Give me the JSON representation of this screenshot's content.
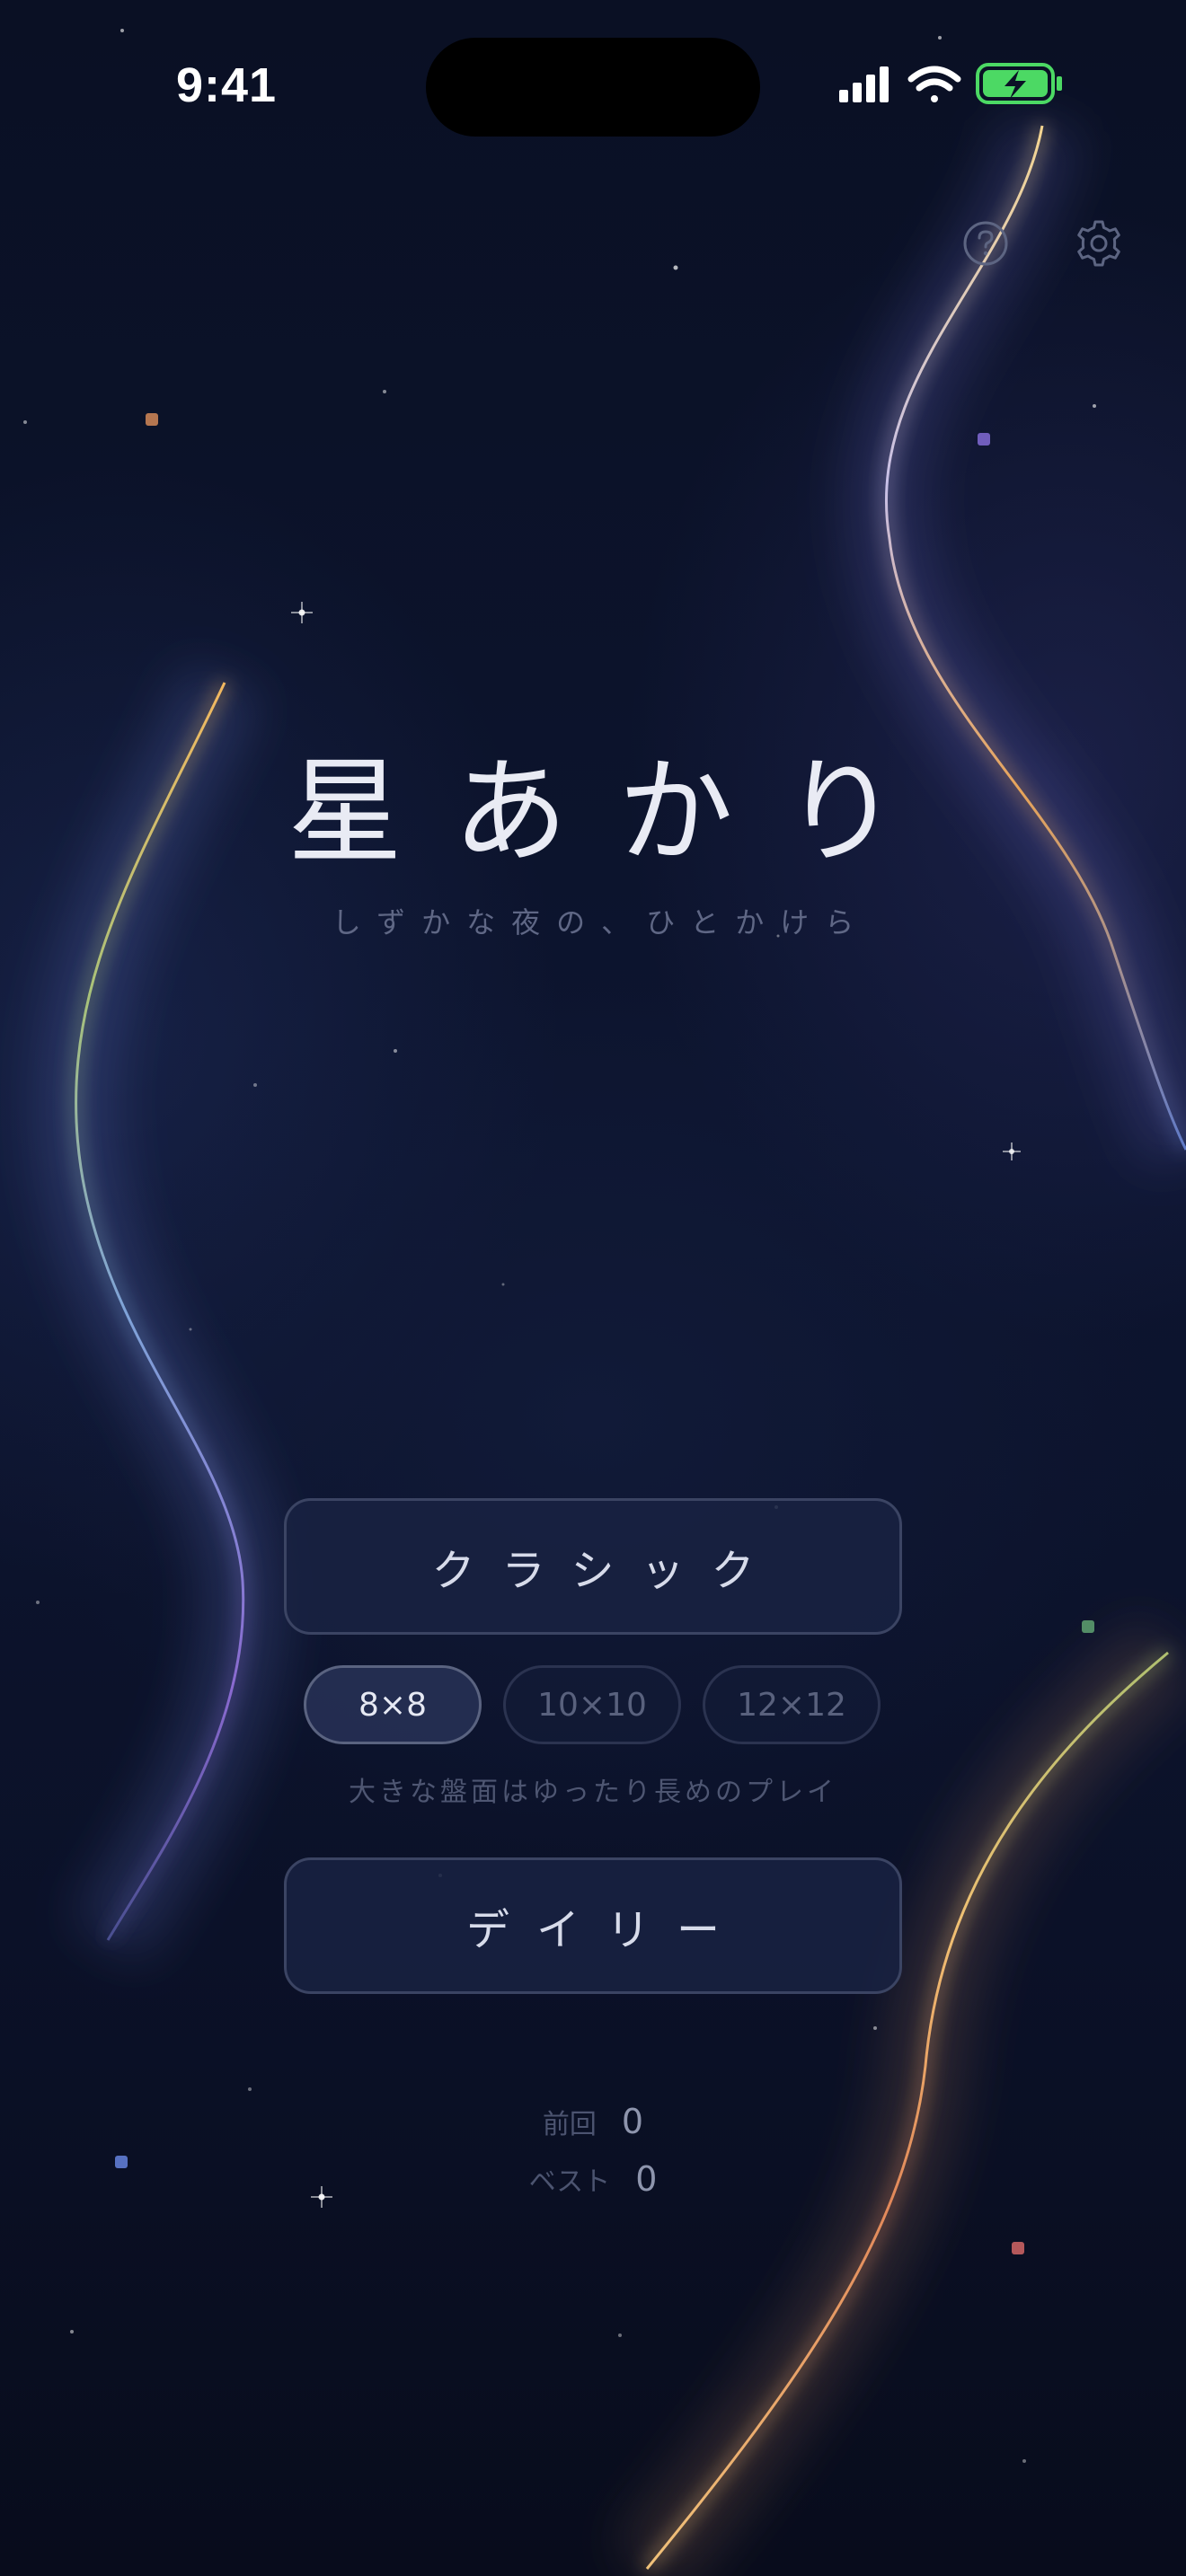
{
  "status_bar": {
    "time": "9:41"
  },
  "header": {
    "help_icon": "help-circle-icon",
    "settings_icon": "gear-icon"
  },
  "title": "星あかり",
  "subtitle": "しずかな夜の、ひとかけら",
  "modes": {
    "classic_label": "クラシック",
    "daily_label": "デイリー"
  },
  "board_sizes": {
    "options": [
      "8×8",
      "10×10",
      "12×12"
    ],
    "selected": "8×8",
    "hint": "大きな盤面はゆったり長めのプレイ"
  },
  "scores": {
    "last_label": "前回",
    "last_value": "0",
    "best_label": "ベスト",
    "best_value": "0"
  },
  "colors": {
    "background": "#0b1126",
    "button_bg": "#192242",
    "button_border": "#3b4463",
    "text_primary": "#e9ebf4",
    "text_muted": "#5f6785",
    "battery": "#4cd964"
  }
}
